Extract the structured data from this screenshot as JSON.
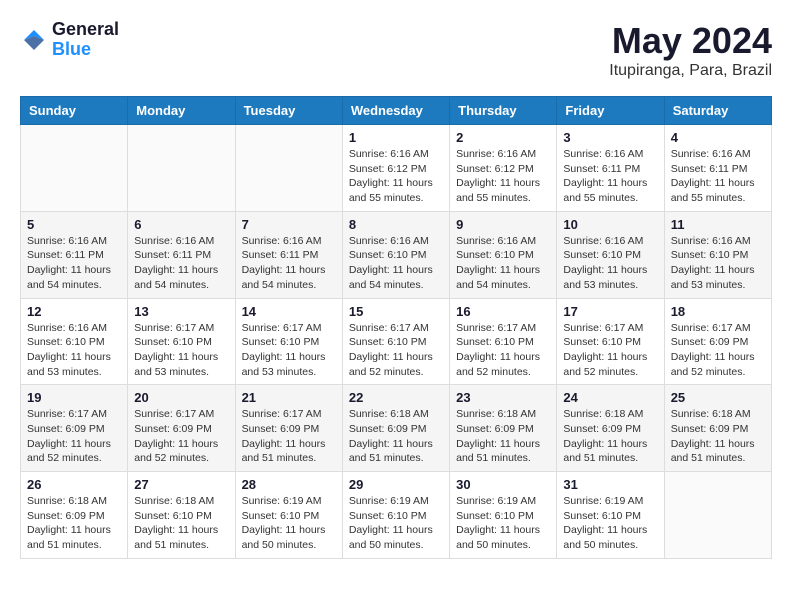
{
  "header": {
    "logo": {
      "general": "General",
      "blue": "Blue"
    },
    "title": "May 2024",
    "location": "Itupiranga, Para, Brazil"
  },
  "weekdays": [
    "Sunday",
    "Monday",
    "Tuesday",
    "Wednesday",
    "Thursday",
    "Friday",
    "Saturday"
  ],
  "weeks": [
    [
      {
        "day": "",
        "sunrise": "",
        "sunset": "",
        "daylight": ""
      },
      {
        "day": "",
        "sunrise": "",
        "sunset": "",
        "daylight": ""
      },
      {
        "day": "",
        "sunrise": "",
        "sunset": "",
        "daylight": ""
      },
      {
        "day": "1",
        "sunrise": "Sunrise: 6:16 AM",
        "sunset": "Sunset: 6:12 PM",
        "daylight": "Daylight: 11 hours and 55 minutes."
      },
      {
        "day": "2",
        "sunrise": "Sunrise: 6:16 AM",
        "sunset": "Sunset: 6:12 PM",
        "daylight": "Daylight: 11 hours and 55 minutes."
      },
      {
        "day": "3",
        "sunrise": "Sunrise: 6:16 AM",
        "sunset": "Sunset: 6:11 PM",
        "daylight": "Daylight: 11 hours and 55 minutes."
      },
      {
        "day": "4",
        "sunrise": "Sunrise: 6:16 AM",
        "sunset": "Sunset: 6:11 PM",
        "daylight": "Daylight: 11 hours and 55 minutes."
      }
    ],
    [
      {
        "day": "5",
        "sunrise": "Sunrise: 6:16 AM",
        "sunset": "Sunset: 6:11 PM",
        "daylight": "Daylight: 11 hours and 54 minutes."
      },
      {
        "day": "6",
        "sunrise": "Sunrise: 6:16 AM",
        "sunset": "Sunset: 6:11 PM",
        "daylight": "Daylight: 11 hours and 54 minutes."
      },
      {
        "day": "7",
        "sunrise": "Sunrise: 6:16 AM",
        "sunset": "Sunset: 6:11 PM",
        "daylight": "Daylight: 11 hours and 54 minutes."
      },
      {
        "day": "8",
        "sunrise": "Sunrise: 6:16 AM",
        "sunset": "Sunset: 6:10 PM",
        "daylight": "Daylight: 11 hours and 54 minutes."
      },
      {
        "day": "9",
        "sunrise": "Sunrise: 6:16 AM",
        "sunset": "Sunset: 6:10 PM",
        "daylight": "Daylight: 11 hours and 54 minutes."
      },
      {
        "day": "10",
        "sunrise": "Sunrise: 6:16 AM",
        "sunset": "Sunset: 6:10 PM",
        "daylight": "Daylight: 11 hours and 53 minutes."
      },
      {
        "day": "11",
        "sunrise": "Sunrise: 6:16 AM",
        "sunset": "Sunset: 6:10 PM",
        "daylight": "Daylight: 11 hours and 53 minutes."
      }
    ],
    [
      {
        "day": "12",
        "sunrise": "Sunrise: 6:16 AM",
        "sunset": "Sunset: 6:10 PM",
        "daylight": "Daylight: 11 hours and 53 minutes."
      },
      {
        "day": "13",
        "sunrise": "Sunrise: 6:17 AM",
        "sunset": "Sunset: 6:10 PM",
        "daylight": "Daylight: 11 hours and 53 minutes."
      },
      {
        "day": "14",
        "sunrise": "Sunrise: 6:17 AM",
        "sunset": "Sunset: 6:10 PM",
        "daylight": "Daylight: 11 hours and 53 minutes."
      },
      {
        "day": "15",
        "sunrise": "Sunrise: 6:17 AM",
        "sunset": "Sunset: 6:10 PM",
        "daylight": "Daylight: 11 hours and 52 minutes."
      },
      {
        "day": "16",
        "sunrise": "Sunrise: 6:17 AM",
        "sunset": "Sunset: 6:10 PM",
        "daylight": "Daylight: 11 hours and 52 minutes."
      },
      {
        "day": "17",
        "sunrise": "Sunrise: 6:17 AM",
        "sunset": "Sunset: 6:10 PM",
        "daylight": "Daylight: 11 hours and 52 minutes."
      },
      {
        "day": "18",
        "sunrise": "Sunrise: 6:17 AM",
        "sunset": "Sunset: 6:09 PM",
        "daylight": "Daylight: 11 hours and 52 minutes."
      }
    ],
    [
      {
        "day": "19",
        "sunrise": "Sunrise: 6:17 AM",
        "sunset": "Sunset: 6:09 PM",
        "daylight": "Daylight: 11 hours and 52 minutes."
      },
      {
        "day": "20",
        "sunrise": "Sunrise: 6:17 AM",
        "sunset": "Sunset: 6:09 PM",
        "daylight": "Daylight: 11 hours and 52 minutes."
      },
      {
        "day": "21",
        "sunrise": "Sunrise: 6:17 AM",
        "sunset": "Sunset: 6:09 PM",
        "daylight": "Daylight: 11 hours and 51 minutes."
      },
      {
        "day": "22",
        "sunrise": "Sunrise: 6:18 AM",
        "sunset": "Sunset: 6:09 PM",
        "daylight": "Daylight: 11 hours and 51 minutes."
      },
      {
        "day": "23",
        "sunrise": "Sunrise: 6:18 AM",
        "sunset": "Sunset: 6:09 PM",
        "daylight": "Daylight: 11 hours and 51 minutes."
      },
      {
        "day": "24",
        "sunrise": "Sunrise: 6:18 AM",
        "sunset": "Sunset: 6:09 PM",
        "daylight": "Daylight: 11 hours and 51 minutes."
      },
      {
        "day": "25",
        "sunrise": "Sunrise: 6:18 AM",
        "sunset": "Sunset: 6:09 PM",
        "daylight": "Daylight: 11 hours and 51 minutes."
      }
    ],
    [
      {
        "day": "26",
        "sunrise": "Sunrise: 6:18 AM",
        "sunset": "Sunset: 6:09 PM",
        "daylight": "Daylight: 11 hours and 51 minutes."
      },
      {
        "day": "27",
        "sunrise": "Sunrise: 6:18 AM",
        "sunset": "Sunset: 6:10 PM",
        "daylight": "Daylight: 11 hours and 51 minutes."
      },
      {
        "day": "28",
        "sunrise": "Sunrise: 6:19 AM",
        "sunset": "Sunset: 6:10 PM",
        "daylight": "Daylight: 11 hours and 50 minutes."
      },
      {
        "day": "29",
        "sunrise": "Sunrise: 6:19 AM",
        "sunset": "Sunset: 6:10 PM",
        "daylight": "Daylight: 11 hours and 50 minutes."
      },
      {
        "day": "30",
        "sunrise": "Sunrise: 6:19 AM",
        "sunset": "Sunset: 6:10 PM",
        "daylight": "Daylight: 11 hours and 50 minutes."
      },
      {
        "day": "31",
        "sunrise": "Sunrise: 6:19 AM",
        "sunset": "Sunset: 6:10 PM",
        "daylight": "Daylight: 11 hours and 50 minutes."
      },
      {
        "day": "",
        "sunrise": "",
        "sunset": "",
        "daylight": ""
      }
    ]
  ]
}
